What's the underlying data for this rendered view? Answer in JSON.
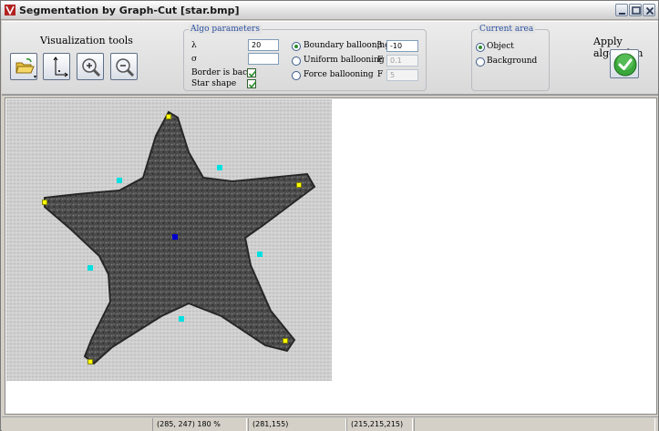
{
  "window": {
    "title": "Segmentation by Graph-Cut [star.bmp]"
  },
  "toolbar": {
    "visualization_label": "Visualization tools",
    "tools": [
      {
        "icon": "open-folder-icon"
      },
      {
        "icon": "axes-icon"
      },
      {
        "icon": "zoom-in-icon"
      },
      {
        "icon": "zoom-out-icon"
      }
    ]
  },
  "algo": {
    "legend": "Algo parameters",
    "lambda_label": "λ",
    "lambda_value": "20",
    "sigma_label": "σ",
    "sigma_value": "",
    "border_is_back_label": "Border is back",
    "border_is_back_checked": true,
    "star_shape_label": "Star shape",
    "star_shape_checked": true,
    "ballooning": [
      {
        "label": "Boundary ballooning",
        "param": "β",
        "value": "-10",
        "selected": true,
        "enabled": true
      },
      {
        "label": "Uniform ballooning",
        "param": "F",
        "value": "0.1",
        "selected": false,
        "enabled": false
      },
      {
        "label": "Force ballooning",
        "param": "F",
        "value": "5",
        "selected": false,
        "enabled": false
      }
    ]
  },
  "current_area": {
    "legend": "Current area",
    "options": [
      {
        "label": "Object",
        "selected": true
      },
      {
        "label": "Background",
        "selected": false
      }
    ]
  },
  "apply": {
    "label": "Apply algorithm",
    "icon": "checkmark-icon"
  },
  "status": {
    "cursor_zoom": "(285, 247) 180 %",
    "pixel_coords": "(281,155)",
    "pixel_color": "(215,215,215)",
    "extra": ""
  },
  "markers": {
    "object_color": "#ffff00",
    "background_color": "#00e0e0",
    "center_color": "#0000cc"
  }
}
